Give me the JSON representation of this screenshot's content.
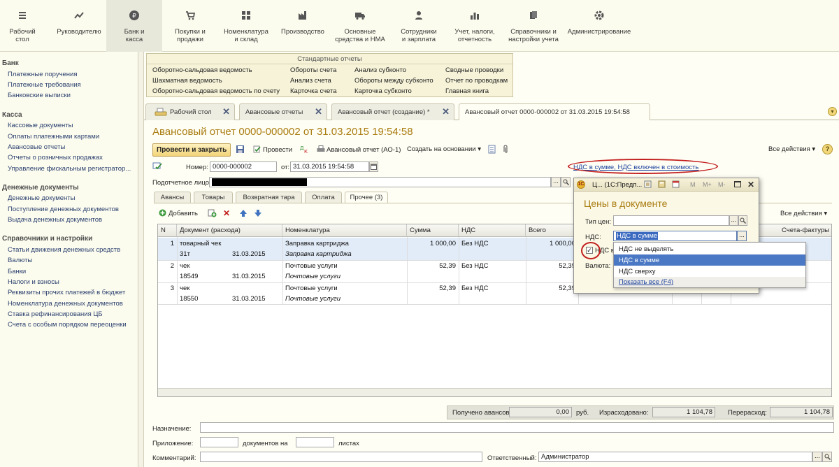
{
  "sections": [
    {
      "label": "Рабочий\nстол",
      "icon": "menu-icon"
    },
    {
      "label": "Руководителю",
      "icon": "trend-icon"
    },
    {
      "label": "Банк и\nкасса",
      "icon": "ruble-icon"
    },
    {
      "label": "Покупки и\nпродажи",
      "icon": "cart-icon"
    },
    {
      "label": "Номенклатура\nи склад",
      "icon": "grid-icon"
    },
    {
      "label": "Производство",
      "icon": "factory-icon"
    },
    {
      "label": "Основные\nсредства и НМА",
      "icon": "truck-icon"
    },
    {
      "label": "Сотрудники\nи зарплата",
      "icon": "person-icon"
    },
    {
      "label": "Учет, налоги,\nотчетность",
      "icon": "bars-icon"
    },
    {
      "label": "Справочники и\nнастройки учета",
      "icon": "books-icon"
    },
    {
      "label": "Администрирование",
      "icon": "gear-icon"
    }
  ],
  "left_panel": {
    "groups": [
      {
        "title": "Банк",
        "items": [
          "Платежные поручения",
          "Платежные требования",
          "Банковские выписки"
        ]
      },
      {
        "title": "Касса",
        "items": [
          "Кассовые документы",
          "Оплаты платежными картами",
          "Авансовые отчеты",
          "Отчеты о розничных продажах",
          "Управление фискальным регистратор..."
        ]
      },
      {
        "title": "Денежные документы",
        "items": [
          "Денежные документы",
          "Поступление денежных документов",
          "Выдача денежных документов"
        ]
      },
      {
        "title": "Справочники и настройки",
        "items": [
          "Статьи движения денежных средств",
          "Валюты",
          "Банки",
          "Налоги и взносы",
          "Реквизиты прочих платежей в бюджет",
          "Номенклатура денежных документов",
          "Ставка рефинансирования ЦБ",
          "Счета с особым порядком переоценки"
        ]
      }
    ]
  },
  "reports": {
    "title": "Стандартные отчеты",
    "col1": [
      "Оборотно-сальдовая ведомость",
      "Шахматная ведомость",
      "Оборотно-сальдовая ведомость по счету"
    ],
    "col2": [
      "Обороты счета",
      "Анализ счета",
      "Карточка счета"
    ],
    "col3": [
      "Анализ субконто",
      "Обороты между субконто",
      "Карточка субконто"
    ],
    "col4": [
      "Сводные проводки",
      "Отчет по проводкам",
      "Главная книга"
    ]
  },
  "tabs": [
    {
      "label": "Рабочий стол"
    },
    {
      "label": "Авансовые отчеты"
    },
    {
      "label": "Авансовый отчет (создание) *"
    },
    {
      "label": "Авансовый отчет 0000-000002 от 31.03.2015 19:54:58"
    }
  ],
  "doc": {
    "title": "Авансовый отчет 0000-000002 от 31.03.2015 19:54:58",
    "toolbar": {
      "post_close": "Провести и закрыть",
      "post": "Провести",
      "print": "Авансовый отчет (АО-1)",
      "create_based": "Создать на основании",
      "all_actions": "Все действия",
      "help": "?"
    },
    "number_label": "Номер:",
    "number": "0000-000002",
    "date_label": "от:",
    "date": "31.03.2015 19:54:58",
    "vat_link": "НДС в сумме, НДС включен в стоимость",
    "person_label": "Подотчетное лицо:",
    "subtabs": [
      "Авансы",
      "Товары",
      "Возвратная тара",
      "Оплата",
      "Прочее (3)"
    ],
    "table_toolbar": {
      "add": "Добавить",
      "all_actions": "Все действия"
    },
    "columns": {
      "n": "N",
      "doc": "Документ (расхода)",
      "item": "Номенклатура",
      "sum": "Сумма",
      "vat": "НДС",
      "total": "Всего",
      "invoice": "Счета-фактуры"
    },
    "rows": [
      {
        "n": "1",
        "doc": "товарный чек",
        "doc_no": "31т",
        "doc_date": "31.03.2015",
        "item": "Заправка картриджа",
        "item_desc": "Заправка картриджа",
        "sum": "1 000,00",
        "vat": "Без НДС",
        "total": "1 000,00"
      },
      {
        "n": "2",
        "doc": "чек",
        "doc_no": "18549",
        "doc_date": "31.03.2015",
        "item": "Почтовые услуги",
        "item_desc": "Почтовые услуги",
        "sum": "52,39",
        "vat": "Без НДС",
        "total": "52,39"
      },
      {
        "n": "3",
        "doc": "чек",
        "doc_no": "18550",
        "doc_date": "31.03.2015",
        "item": "Почтовые услуги",
        "item_desc": "Почтовые услуги",
        "sum": "52,39",
        "vat": "Без НДС",
        "total": "52,39"
      }
    ],
    "totals": {
      "received_label": "Получено авансов:",
      "received": "0,00",
      "currency": "руб.",
      "spent_label": "Израсходовано:",
      "spent": "1 104,78",
      "overspent_label": "Перерасход:",
      "overspent": "1 104,78"
    },
    "purpose_label": "Назначение:",
    "attachment_label": "Приложение:",
    "docs_on": "документов на",
    "sheets": "листах",
    "comment_label": "Комментарий:",
    "responsible_label": "Ответственный:",
    "responsible": "Администратор"
  },
  "popup": {
    "window_title": "Ц... (1С:Предп...",
    "heading": "Цены в документе",
    "price_type_label": "Тип цен:",
    "vat_label": "НДС:",
    "vat_value": "НДС в сумме",
    "vat_included_label": "НДС в",
    "currency_label": "Валюта:",
    "title_buttons": [
      "M",
      "M+",
      "M-"
    ],
    "dropdown": [
      "НДС не выделять",
      "НДС в сумме",
      "НДС сверху",
      "Показать все (F4)"
    ]
  },
  "colors": {
    "title": "#a97c10",
    "link": "#1e44a0",
    "highlight": "#c21f1f",
    "selected": "#4a78c4"
  }
}
